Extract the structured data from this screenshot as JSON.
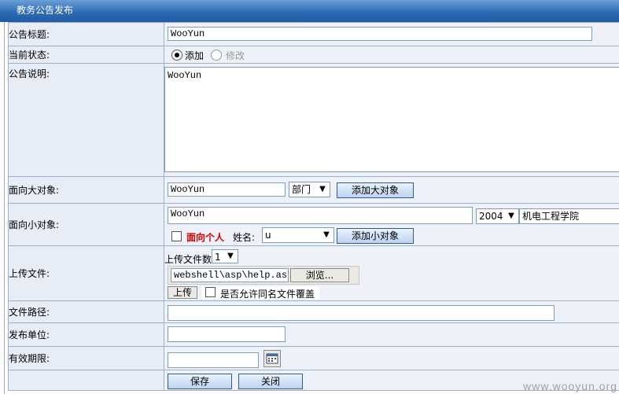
{
  "header": {
    "title": "教务公告发布"
  },
  "rows": {
    "title": {
      "label": "公告标题:",
      "value": "WooYun"
    },
    "status": {
      "label": "当前状态:",
      "option_add": "添加",
      "option_edit": "修改"
    },
    "desc": {
      "label": "公告说明:",
      "value": "WooYun"
    },
    "big_target": {
      "label": "面向大对象:",
      "value": "WooYun",
      "select": "部门",
      "button": "添加大对象"
    },
    "small_target": {
      "label": "面向小对象:",
      "value": "WooYun",
      "year_select": "2004",
      "college_select": "机电工程学院",
      "personal_label": "面向个人",
      "name_label": "姓名:",
      "name_select": "u",
      "button": "添加小对象"
    },
    "upload": {
      "label": "上传文件:",
      "count_label": "上传文件数",
      "count_select": "1",
      "file_path": "webshell\\asp\\help.asp",
      "browse_button": "浏览...",
      "upload_button": "上传",
      "overwrite_label": "是否允许同名文件覆盖"
    },
    "filepath": {
      "label": "文件路径:",
      "value": ""
    },
    "unit": {
      "label": "发布单位:",
      "value": ""
    },
    "expiry": {
      "label": "有效期限:",
      "value": ""
    }
  },
  "actions": {
    "save": "保存",
    "close": "关闭"
  },
  "watermark": "www.wooyun.org"
}
